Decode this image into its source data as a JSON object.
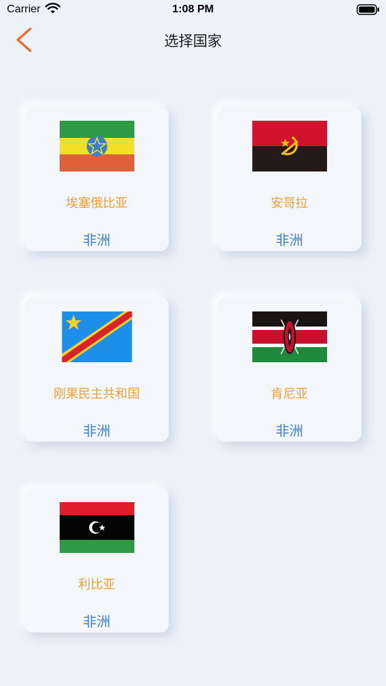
{
  "status_bar": {
    "carrier": "Carrier",
    "time": "1:08 PM"
  },
  "nav": {
    "title": "选择国家",
    "back_icon": "chevron-left-icon",
    "accent_color": "#f06a2a"
  },
  "colors": {
    "country_name": "#f0a030",
    "continent": "#3f7fd1",
    "background": "#edf2f8"
  },
  "countries": [
    {
      "name": "埃塞俄比亚",
      "continent": "非洲",
      "flag": "ethiopia-flag-icon"
    },
    {
      "name": "安哥拉",
      "continent": "非洲",
      "flag": "angola-flag-icon"
    },
    {
      "name": "刚果民主共和国",
      "continent": "非洲",
      "flag": "dr-congo-flag-icon"
    },
    {
      "name": "肯尼亚",
      "continent": "非洲",
      "flag": "kenya-flag-icon"
    },
    {
      "name": "利比亚",
      "continent": "非洲",
      "flag": "libya-flag-icon"
    }
  ]
}
